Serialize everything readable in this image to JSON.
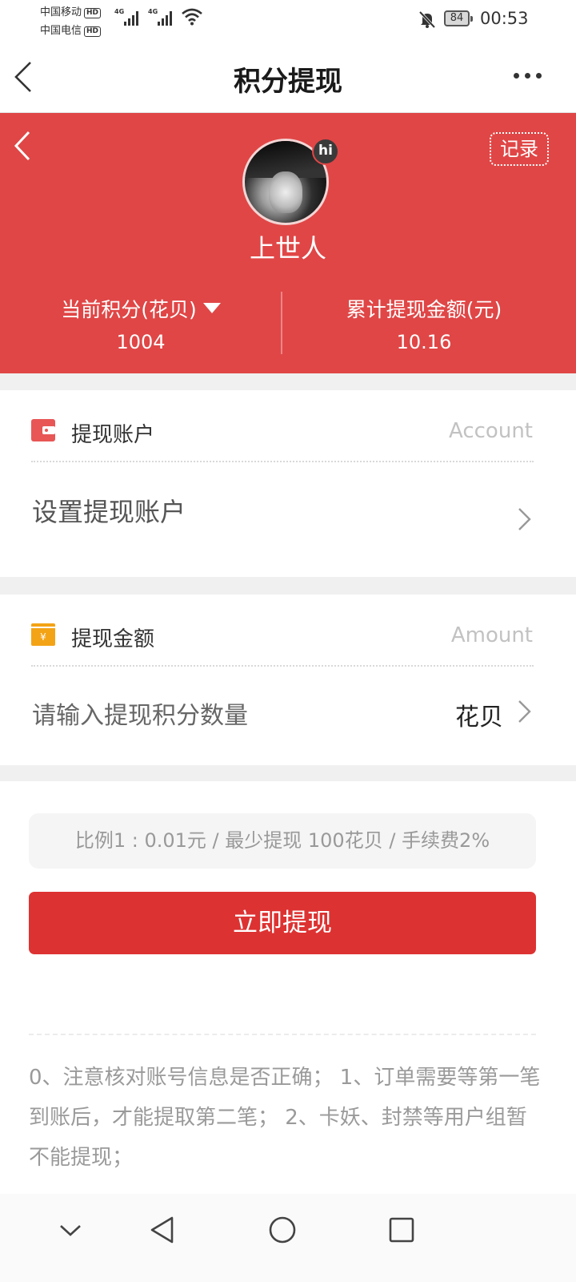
{
  "status_bar": {
    "carrier1": "中国移动",
    "carrier2": "中国电信",
    "hd": "HD",
    "network1": "4G",
    "network2": "4G",
    "battery": "84",
    "time": "00:53"
  },
  "navbar": {
    "title": "积分提现",
    "back_icon": "chevron-left-icon",
    "more_icon": "more-dots-icon"
  },
  "header": {
    "background_color": "#e04646",
    "record_button": "记录",
    "avatar_badge": "hi",
    "username": "上世人",
    "points_label": "当前积分(花贝)",
    "points_value": "1004",
    "withdrawn_label": "累计提现金额(元)",
    "withdrawn_value": "10.16"
  },
  "account_card": {
    "icon": "wallet-icon",
    "title": "提现账户",
    "subtitle": "Account",
    "row_label": "设置提现账户"
  },
  "amount_card": {
    "icon": "yen-card-icon",
    "title": "提现金额",
    "subtitle": "Amount",
    "input_placeholder": "请输入提现积分数量",
    "unit": "花贝"
  },
  "info": {
    "text": "比例1 : 0.01元 / 最少提现 100花贝 / 手续费2%"
  },
  "submit_button": {
    "label": "立即提现",
    "color": "#dd3232"
  },
  "notes": {
    "text": "0、注意核对账号信息是否正确； 1、订单需要等第一笔到账后，才能提取第二笔； 2、卡妖、封禁等用户组暂不能提现；"
  },
  "system_nav": {
    "icons": [
      "collapse-icon",
      "back-icon",
      "home-icon",
      "recents-icon"
    ]
  }
}
